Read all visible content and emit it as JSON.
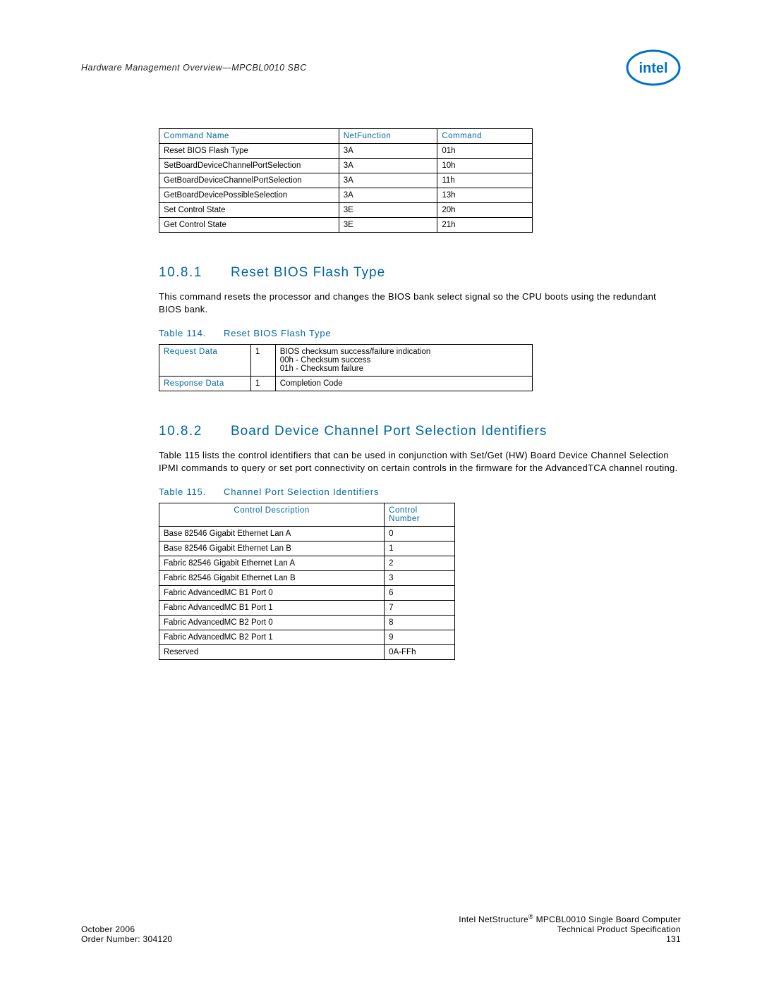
{
  "header": {
    "text": "Hardware Management Overview—MPCBL0010 SBC"
  },
  "table1": {
    "headers": {
      "c1": "Command Name",
      "c2": "NetFunction",
      "c3": "Command"
    },
    "rows": [
      {
        "c1": "Reset BIOS Flash Type",
        "c2": "3A",
        "c3": "01h"
      },
      {
        "c1": "SetBoardDeviceChannelPortSelection",
        "c2": "3A",
        "c3": "10h"
      },
      {
        "c1": "GetBoardDeviceChannelPortSelection",
        "c2": "3A",
        "c3": "11h"
      },
      {
        "c1": "GetBoardDevicePossibleSelection",
        "c2": "3A",
        "c3": "13h"
      },
      {
        "c1": "Set Control State",
        "c2": "3E",
        "c3": "20h"
      },
      {
        "c1": "Get Control State",
        "c2": "3E",
        "c3": "21h"
      }
    ]
  },
  "section1": {
    "num": "10.8.1",
    "title": "Reset BIOS Flash Type",
    "para": "This command resets the processor and changes the BIOS bank select signal so the CPU boots using the redundant BIOS bank.",
    "caption_num": "Table 114.",
    "caption_title": "Reset BIOS Flash Type"
  },
  "table2": {
    "rows": [
      {
        "c1": "Request Data",
        "c2": "1",
        "c3": "BIOS checksum success/failure indication\n00h - Checksum success\n01h - Checksum failure"
      },
      {
        "c1": "Response Data",
        "c2": "1",
        "c3": "Completion Code"
      }
    ]
  },
  "section2": {
    "num": "10.8.2",
    "title": "Board Device Channel Port Selection Identifiers",
    "para": "Table 115 lists the control identifiers that can be used in conjunction with Set/Get (HW) Board Device Channel Selection IPMI commands to query or set port connectivity on certain controls in the firmware for the AdvancedTCA channel routing.",
    "caption_num": "Table 115.",
    "caption_title": "Channel Port Selection Identifiers"
  },
  "table3": {
    "headers": {
      "c1": "Control Description",
      "c2": "Control Number"
    },
    "rows": [
      {
        "c1": "Base 82546 Gigabit Ethernet Lan A",
        "c2": "0"
      },
      {
        "c1": "Base 82546 Gigabit Ethernet Lan B",
        "c2": "1"
      },
      {
        "c1": "Fabric 82546 Gigabit Ethernet Lan A",
        "c2": "2"
      },
      {
        "c1": "Fabric 82546 Gigabit Ethernet Lan B",
        "c2": "3"
      },
      {
        "c1": "Fabric AdvancedMC B1 Port 0",
        "c2": "6"
      },
      {
        "c1": "Fabric AdvancedMC B1 Port 1",
        "c2": "7"
      },
      {
        "c1": "Fabric AdvancedMC B2 Port 0",
        "c2": "8"
      },
      {
        "c1": "Fabric AdvancedMC B2 Port 1",
        "c2": "9"
      },
      {
        "c1": "Reserved",
        "c2": "0A-FFh"
      }
    ]
  },
  "footer": {
    "right1_a": "Intel NetStructure",
    "right1_b": " MPCBL0010 Single Board Computer",
    "left1": "October 2006",
    "right2": "Technical Product Specification",
    "left2": "Order Number: 304120",
    "right3": "131"
  }
}
